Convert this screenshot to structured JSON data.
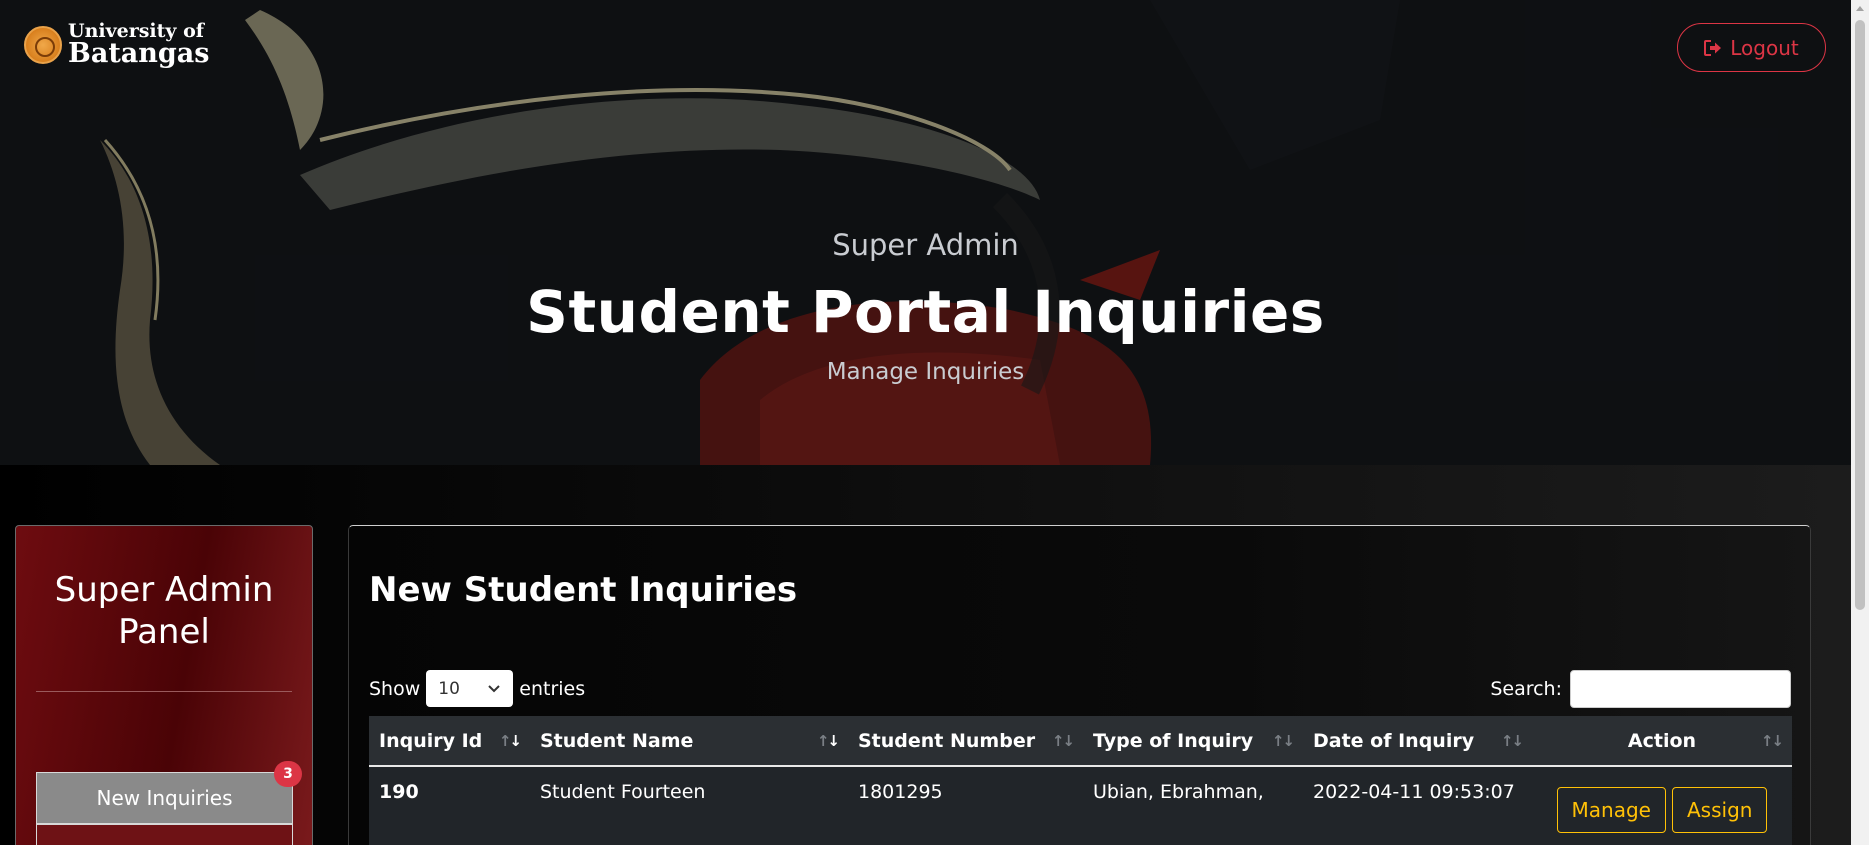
{
  "brand": {
    "line1": "University of",
    "line2": "Batangas"
  },
  "header": {
    "logout_label": "Logout"
  },
  "hero": {
    "subtitle": "Super Admin",
    "title": "Student Portal Inquiries",
    "lead": "Manage Inquiries"
  },
  "sidebar": {
    "title": "Super Admin Panel",
    "items": [
      {
        "label": "New Inquiries",
        "badge": "3",
        "active": true
      }
    ]
  },
  "card": {
    "title": "New Student Inquiries",
    "show_label": "Show",
    "entries_label": "entries",
    "page_length": "10",
    "search_label": "Search:",
    "search_value": ""
  },
  "table": {
    "columns": [
      "Inquiry Id",
      "Student Name",
      "Student Number",
      "Type of Inquiry",
      "Date of Inquiry",
      "Action"
    ],
    "rows": [
      {
        "id": "190",
        "student_name": "Student Fourteen",
        "student_number": "1801295",
        "type": "Ubian, Ebrahman,",
        "date": "2022-04-11 09:53:07",
        "manage_label": "Manage",
        "assign_label": "Assign"
      }
    ]
  },
  "colors": {
    "danger": "#dc3545",
    "warning": "#ffc107",
    "sidebar_red": "#6e0c10",
    "table_bg": "#212529"
  },
  "icons": {
    "logout": "sign-out-icon",
    "select": "chevron-down-icon"
  }
}
